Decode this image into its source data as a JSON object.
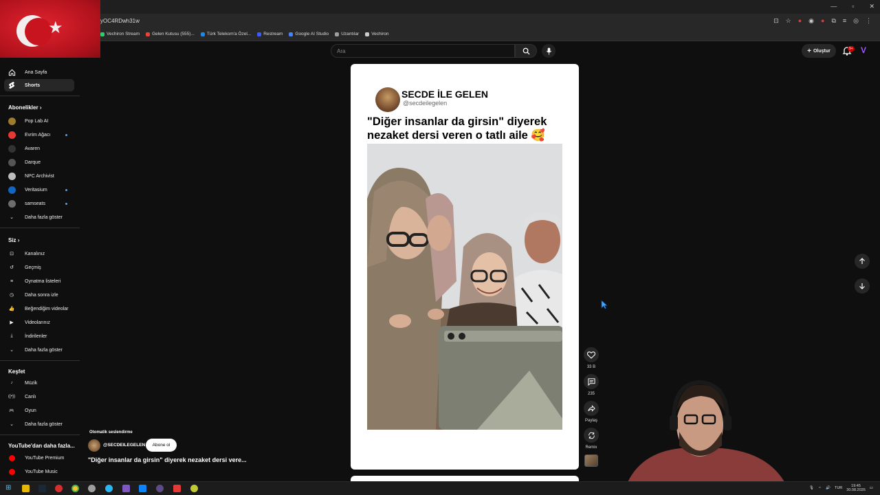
{
  "browser": {
    "url": "yOC4RDwh31w",
    "bookmarks": [
      {
        "label": "Vechiron Stream",
        "color": "#2ecc71"
      },
      {
        "label": "Gelen Kutusu (555)...",
        "color": "#ea4335"
      },
      {
        "label": "Türk Telekom'a Özel...",
        "color": "#1e88e5"
      },
      {
        "label": "Restream",
        "color": "#3d5afe"
      },
      {
        "label": "Google AI Studio",
        "color": "#4285f4"
      },
      {
        "label": "Uzantılar",
        "color": "#9e9e9e"
      },
      {
        "label": "Vechiron",
        "color": "#cccccc"
      }
    ]
  },
  "header": {
    "search_placeholder": "Ara",
    "create_label": "Oluştur",
    "notif_badge": "9+"
  },
  "sidebar": {
    "home": "Ana Sayfa",
    "shorts": "Shorts",
    "subs_head": "Abonelikler",
    "channels": [
      {
        "name": "Pop Lab AI",
        "color": "#9e7b2f",
        "dot": false
      },
      {
        "name": "Evrim Ağacı",
        "color": "#e53935",
        "dot": true
      },
      {
        "name": "Avaren",
        "color": "#333333",
        "dot": false
      },
      {
        "name": "Darque",
        "color": "#555555",
        "dot": false
      },
      {
        "name": "NPC Archivist",
        "color": "#bdbdbd",
        "dot": false
      },
      {
        "name": "Veritasium",
        "color": "#1565c0",
        "dot": true
      },
      {
        "name": "samseats",
        "color": "#6d6d6d",
        "dot": true
      }
    ],
    "show_more": "Daha fazla göster",
    "you_head": "Siz",
    "you_items": [
      "Kanalınız",
      "Geçmiş",
      "Oynatma listeleri",
      "Daha sonra izle",
      "Beğendiğim videolar",
      "Videolarınız",
      "İndirilenler"
    ],
    "explore_head": "Keşfet",
    "explore_items": [
      "Müzik",
      "Canlı",
      "Oyun"
    ],
    "more_head": "YouTube'dan daha fazla...",
    "more_items": [
      {
        "label": "YouTube Premium",
        "color": "#ff0000"
      },
      {
        "label": "YouTube Music",
        "color": "#ff0000"
      }
    ]
  },
  "short": {
    "profile_name": "SECDE İLE GELEN",
    "profile_handle": "@secdeilegelen",
    "title": "\"Diğer insanlar da girsin\" diyerek nezaket dersi veren o tatlı aile 🥰"
  },
  "actions": {
    "likes": "33 B",
    "comments": "235",
    "share": "Paylaş",
    "remix": "Remix"
  },
  "info": {
    "auto_dub": "Otomatik seslendirme",
    "channel": "@SECDEILEGELEN",
    "subscribe": "Abone ol",
    "title": "\"Diğer insanlar da girsin\" diyerek nezaket dersi vere..."
  },
  "tray": {
    "lang": "TUR",
    "time": "19:45",
    "date": "30.08.2026"
  }
}
